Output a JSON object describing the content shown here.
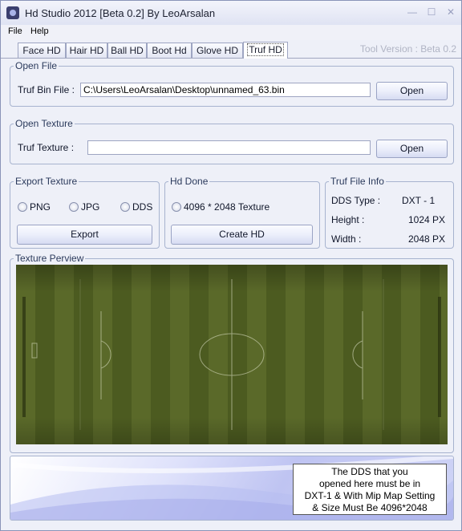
{
  "window": {
    "title": "Hd Studio 2012  [Beta 0.2] By LeoArsalan"
  },
  "menu": {
    "file": "File",
    "help": "Help"
  },
  "tabs": [
    {
      "label": "Face HD"
    },
    {
      "label": "Hair HD"
    },
    {
      "label": "Ball HD"
    },
    {
      "label": "Boot Hd"
    },
    {
      "label": "Glove HD"
    },
    {
      "label": "Truf HD"
    }
  ],
  "tool_version": "Tool Version : Beta 0.2",
  "open_file": {
    "legend": "Open File",
    "label": "Truf Bin File :",
    "value": "C:\\Users\\LeoArsalan\\Desktop\\unnamed_63.bin",
    "button": "Open"
  },
  "open_texture": {
    "legend": "Open Texture",
    "label": "Truf Texture :",
    "value": "",
    "button": "Open"
  },
  "export_texture": {
    "legend": "Export Texture",
    "options": [
      "PNG",
      "JPG",
      "DDS"
    ],
    "button": "Export"
  },
  "hd_done": {
    "legend": "Hd Done",
    "option": "4096 * 2048 Texture",
    "button": "Create HD"
  },
  "file_info": {
    "legend": "Truf  File Info",
    "dds_type_label": "DDS Type :",
    "dds_type_value": "DXT - 1",
    "height_label": "Height :",
    "height_value": "1024 PX",
    "width_label": "Width :",
    "width_value": "2048 PX"
  },
  "preview": {
    "legend": "Texture Perview"
  },
  "note": {
    "line1": "The DDS that you",
    "line2": "opened here must be in",
    "line3": "DXT-1 & With Mip Map Setting",
    "line4": "& Size Must Be 4096*2048"
  },
  "colors": {
    "pitch_dark": "#4a5a1e",
    "pitch_light": "#5c6b2a",
    "accent_button": "#d6dbf2"
  }
}
